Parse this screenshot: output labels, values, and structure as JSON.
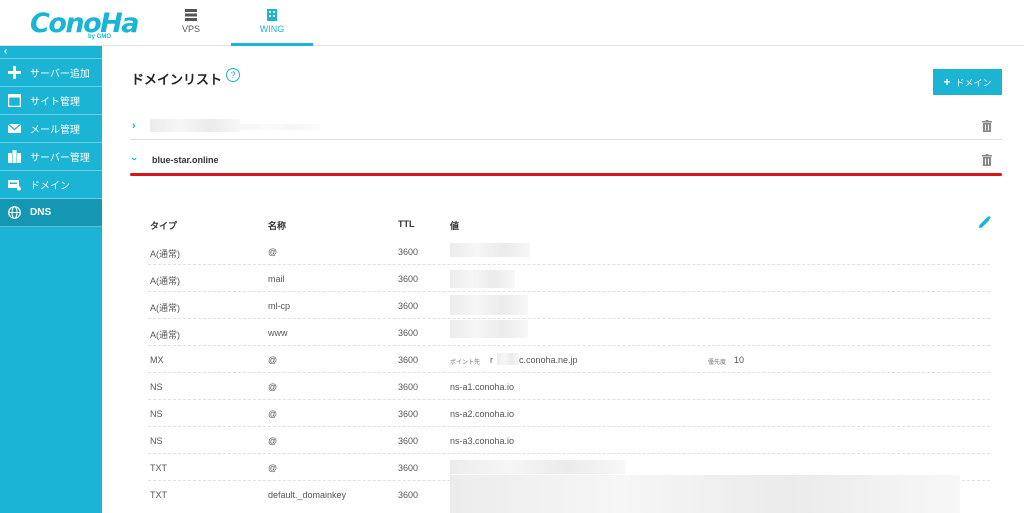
{
  "header": {
    "logo_text": "ConoHa",
    "logo_sub": "by GMO",
    "tabs": [
      {
        "label": "VPS",
        "icon": "server-icon"
      },
      {
        "label": "WING",
        "icon": "building-icon"
      }
    ]
  },
  "sidebar": {
    "collapse_glyph": "‹",
    "items": [
      {
        "label": "サーバー追加",
        "icon": "plus-icon"
      },
      {
        "label": "サイト管理",
        "icon": "window-icon"
      },
      {
        "label": "メール管理",
        "icon": "mail-icon"
      },
      {
        "label": "サーバー管理",
        "icon": "server-manage-icon"
      },
      {
        "label": "ドメイン",
        "icon": "domain-icon"
      },
      {
        "label": "DNS",
        "icon": "globe-icon"
      }
    ]
  },
  "main": {
    "title": "ドメインリスト",
    "help_glyph": "?",
    "add_button": {
      "plus": "+",
      "label": "ドメイン"
    },
    "domains": [
      {
        "name": "",
        "expanded": false
      },
      {
        "name": "blue-star.online",
        "expanded": true
      }
    ],
    "dns": {
      "headers": {
        "type": "タイプ",
        "name": "名称",
        "ttl": "TTL",
        "value": "値"
      },
      "rows": [
        {
          "type": "A(通常)",
          "name": "@",
          "ttl": "3600",
          "value": ""
        },
        {
          "type": "A(通常)",
          "name": "mail",
          "ttl": "3600",
          "value": ""
        },
        {
          "type": "A(通常)",
          "name": "ml-cp",
          "ttl": "3600",
          "value": ""
        },
        {
          "type": "A(通常)",
          "name": "www",
          "ttl": "3600",
          "value": ""
        },
        {
          "type": "MX",
          "name": "@",
          "ttl": "3600",
          "point_label": "ポイント先",
          "value_prefix": "r",
          "value": "c.conoha.ne.jp",
          "priority_label": "優先度",
          "priority": "10"
        },
        {
          "type": "NS",
          "name": "@",
          "ttl": "3600",
          "value": "ns-a1.conoha.io"
        },
        {
          "type": "NS",
          "name": "@",
          "ttl": "3600",
          "value": "ns-a2.conoha.io"
        },
        {
          "type": "NS",
          "name": "@",
          "ttl": "3600",
          "value": "ns-a3.conoha.io"
        },
        {
          "type": "TXT",
          "name": "@",
          "ttl": "3600",
          "value": ""
        },
        {
          "type": "TXT",
          "name": "default._domainkey",
          "ttl": "3600",
          "value": ""
        }
      ]
    }
  },
  "colors": {
    "accent": "#1cb4d5",
    "sidebar_active": "#1497b3",
    "highlight": "#d9141e"
  }
}
